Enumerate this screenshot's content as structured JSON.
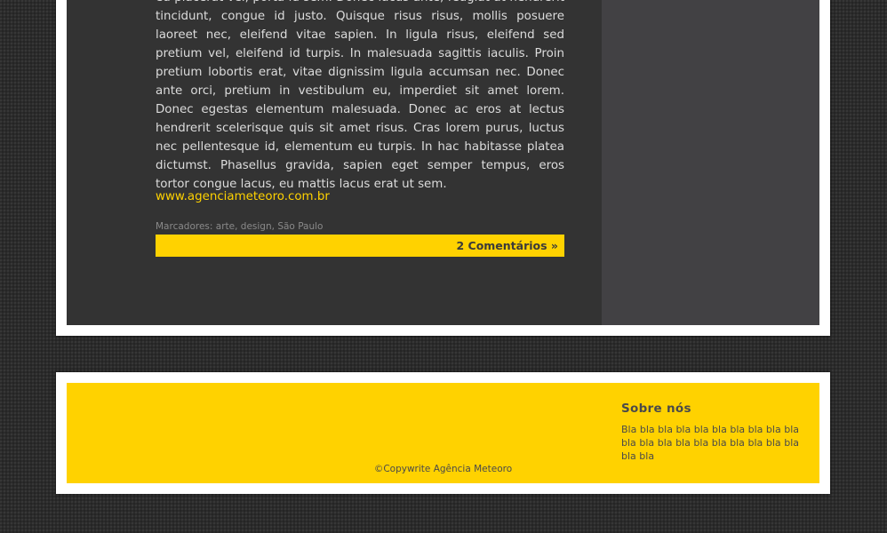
{
  "post": {
    "body": "eu placerat vel, porta id sem. Donec lacus ante, feugiat at hendrerit tincidunt, congue id justo. Quisque risus risus, mollis posuere laoreet nec, eleifend vitae sapien. In ligula risus, eleifend sed pretium vel, eleifend id turpis. In malesuada sagittis iaculis. Proin pretium lobortis erat, vitae dignissim ligula accumsan nec. Donec ante orci, pretium in vestibulum eu, imperdiet sit amet lorem. Donec egestas elementum malesuada. Donec ac eros at lectus hendrerit scelerisque quis sit amet risus. Cras lorem purus, luctus nec pellentesque id, elementum eu turpis. In hac habitasse platea dictumst. Phasellus gravida, sapien eget semper tempus, eros tortor congue lacus, eu mattis lacus erat ut sem.",
    "link_text": "www.agenciameteoro.com.br",
    "tags_label": "Marcadores:",
    "tags": [
      "arte",
      "design",
      "São Paulo"
    ],
    "tag_separator": ", ",
    "comments_label": "2 Comentários »"
  },
  "footer": {
    "about_heading": "Sobre nós",
    "about_text": "Bla bla bla bla bla bla bla bla bla bla bla bla bla bla bla bla bla bla bla bla bla bla",
    "copyright": "©Copywrite Agência Meteoro"
  },
  "colors": {
    "accent": "#ffd200",
    "content_bg": "#333333",
    "sidebar_bg": "#424144",
    "frame": "#ffffff",
    "page_bg": "#2b2b2b"
  }
}
